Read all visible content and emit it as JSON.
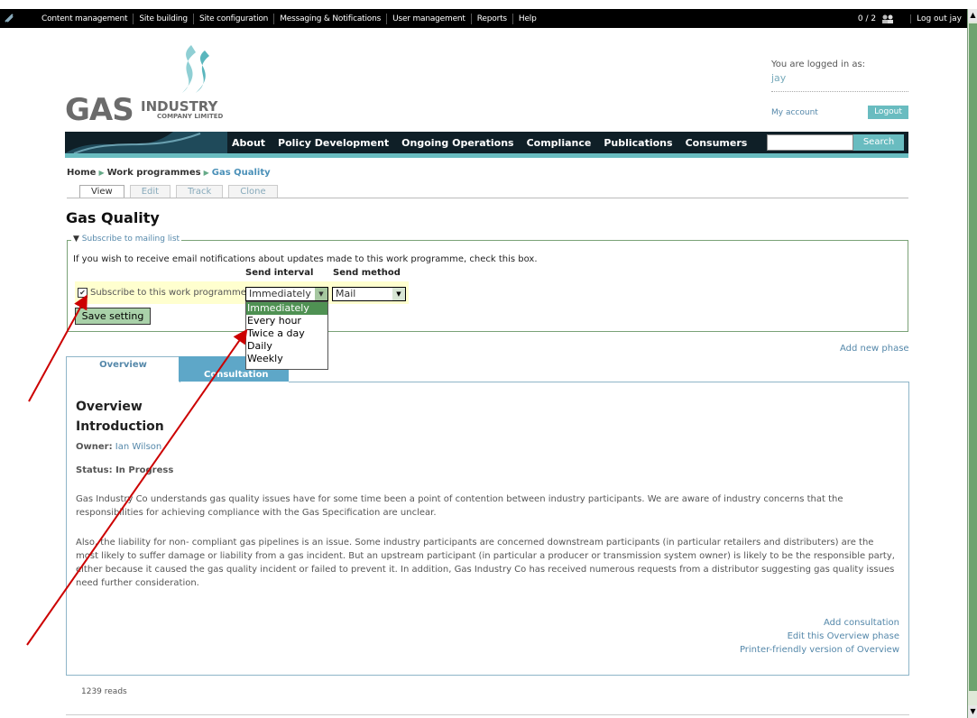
{
  "admin_bar": {
    "menu": [
      "Content management",
      "Site building",
      "Site configuration",
      "Messaging & Notifications",
      "User management",
      "Reports",
      "Help"
    ],
    "counter": "0 / 2",
    "logout": "Log out jay"
  },
  "logo": {
    "gas": "GAS",
    "industry": "INDUSTRY",
    "company": "COMPANY LIMITED"
  },
  "login": {
    "label": "You are logged in as:",
    "user": "jay",
    "my_account": "My account",
    "logout": "Logout"
  },
  "nav": {
    "items": [
      "About",
      "Policy Development",
      "Ongoing Operations",
      "Compliance",
      "Publications",
      "Consumers"
    ],
    "search_value": "",
    "search_button": "Search"
  },
  "breadcrumb": {
    "home": "Home",
    "section": "Work programmes",
    "current": "Gas Quality"
  },
  "tabs": [
    "View",
    "Edit",
    "Track",
    "Clone"
  ],
  "page_title": "Gas Quality",
  "subscribe": {
    "legend": "Subscribe to mailing list",
    "description": "If you wish to receive email notifications about updates made to this work programme, check this box.",
    "col_interval": "Send interval",
    "col_method": "Send method",
    "checkbox_label": "Subscribe to this work programme",
    "checked": true,
    "interval_value": "Immediately",
    "method_value": "Mail",
    "interval_options": [
      "Immediately",
      "Every hour",
      "Twice a day",
      "Daily",
      "Weekly"
    ],
    "save_button": "Save setting"
  },
  "add_new_phase": "Add new phase",
  "phase_tabs": [
    "Overview",
    "Consultation"
  ],
  "content": {
    "heading": "Overview",
    "subheading": "Introduction",
    "owner_label": "Owner:",
    "owner_name": "Ian Wilson",
    "status": "Status: In Progress",
    "paragraphs": [
      "Gas Industry Co understands gas quality issues have for some time been a point of contention between industry participants. We are aware of industry concerns that the responsibilities for achieving compliance with the Gas Specification are unclear.",
      "Also, the liability for non- compliant gas pipelines is an issue. Some industry participants are concerned downstream participants (in particular retailers and distributers) are the most likely to suffer damage or liability from a gas incident. But an upstream participant (in particular a producer or transmission system owner) is likely to be the responsible party, either because it caused the gas quality incident or failed to prevent it. In addition, Gas Industry Co has received numerous requests from a distributor suggesting gas quality issues need further consideration."
    ],
    "links": [
      "Add consultation",
      "Edit this Overview phase",
      "Printer-friendly version of Overview"
    ]
  },
  "reads": "1239 reads",
  "colors": {
    "accent": "#69bcc0",
    "nav_bg": "#0f1f27",
    "link": "#5588aa",
    "arrow": "#cc0000"
  }
}
